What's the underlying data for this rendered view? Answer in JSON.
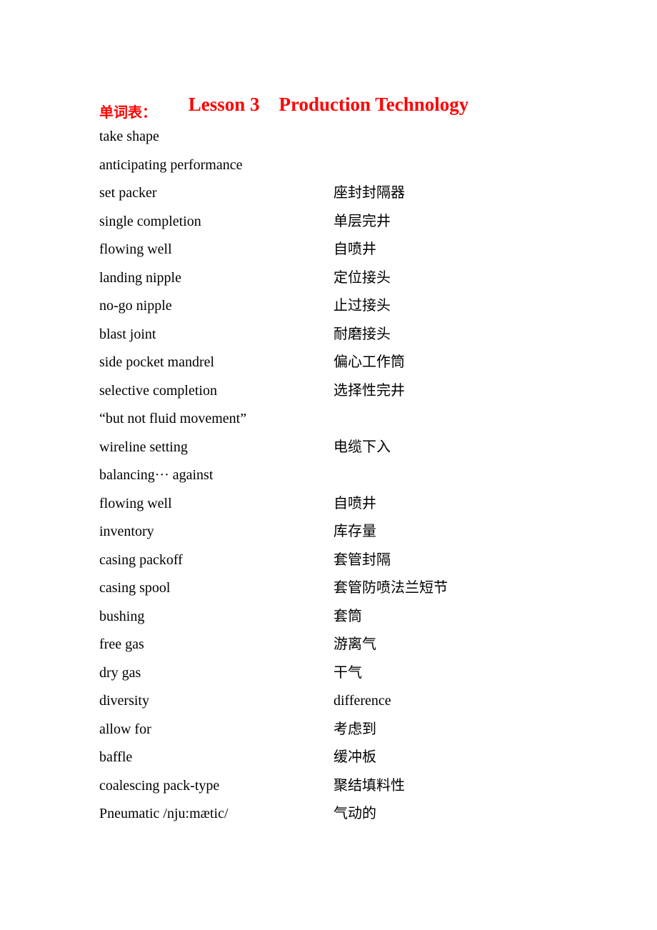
{
  "document": {
    "title": "Lesson 3    Production Technology",
    "vocab_heading": "单词表：",
    "accent_color": "#ff0000",
    "vocab": [
      {
        "term": "take shape",
        "definition": ""
      },
      {
        "term": "anticipating performance",
        "definition": ""
      },
      {
        "term": "set packer",
        "definition": "座封封隔器"
      },
      {
        "term": "single completion",
        "definition": "单层完井"
      },
      {
        "term": "flowing well",
        "definition": "自喷井"
      },
      {
        "term": "landing nipple",
        "definition": "定位接头"
      },
      {
        "term": "no-go nipple",
        "definition": "止过接头"
      },
      {
        "term": "blast joint",
        "definition": "耐磨接头"
      },
      {
        "term": "side pocket mandrel",
        "definition": "偏心工作筒"
      },
      {
        "term": "selective completion",
        "definition": "选择性完井"
      },
      {
        "term": "“but not fluid movement”",
        "definition": ""
      },
      {
        "term": "wireline setting",
        "definition": "电缆下入"
      },
      {
        "term": "balancing··· against",
        "definition": ""
      },
      {
        "term": "flowing well",
        "definition": "自喷井"
      },
      {
        "term": "inventory",
        "definition": "库存量"
      },
      {
        "term": "casing packoff",
        "definition": "套管封隔"
      },
      {
        "term": "casing spool",
        "definition": "套管防喷法兰短节"
      },
      {
        "term": "bushing",
        "definition": "套筒"
      },
      {
        "term": "free gas",
        "definition": "游离气"
      },
      {
        "term": "dry gas",
        "definition": "干气"
      },
      {
        "term": "diversity",
        "definition": "difference"
      },
      {
        "term": "allow for",
        "definition": "考虑到"
      },
      {
        "term": "baffle",
        "definition": "缓冲板"
      },
      {
        "term": "coalescing pack-type",
        "definition": "聚结填料性"
      },
      {
        "term": "Pneumatic /nju:mætic/",
        "definition": "气动的"
      }
    ]
  }
}
